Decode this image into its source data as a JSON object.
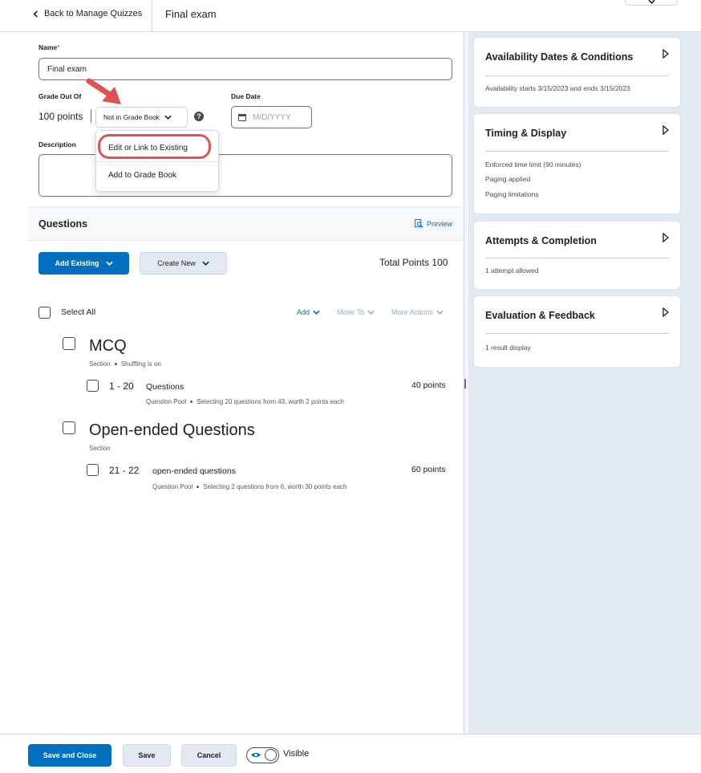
{
  "header": {
    "back_label": "Back to Manage Quizzes",
    "title": "Final exam"
  },
  "form": {
    "name_label": "Name",
    "name_required_mark": "*",
    "name_value": "Final exam",
    "grade_label": "Grade Out Of",
    "grade_points": "100 points",
    "gradebook_select": "Not in Grade Book",
    "help_glyph": "?",
    "due_label": "Due Date",
    "due_placeholder": "M/D/YYYY",
    "description_label": "Description"
  },
  "gradebook_menu": {
    "items": [
      {
        "label": "Edit or Link to Existing"
      },
      {
        "label": "Add to Grade Book"
      }
    ]
  },
  "questions": {
    "title": "Questions",
    "preview": "Preview",
    "add_existing": "Add Existing",
    "create_new": "Create New",
    "total_points": "Total Points 100",
    "select_all": "Select All",
    "toolbar": {
      "add": "Add",
      "move_to": "Move To",
      "more_actions": "More Actions"
    },
    "sections": [
      {
        "title": "MCQ",
        "meta_type": "Section",
        "meta_extra": "Shuffling is on",
        "pool": {
          "range": "1 - 20",
          "name": "Questions",
          "points": "40 points",
          "meta_type": "Question Pool",
          "meta_detail": "Selecting 20 questions from 43, worth 2 points each"
        }
      },
      {
        "title": "Open-ended Questions",
        "meta_type": "Section",
        "pool": {
          "range": "21 - 22",
          "name": "open-ended questions",
          "points": "60 points",
          "meta_type": "Question Pool",
          "meta_detail": "Selecting 2 questions from 6, worth 30 points each"
        }
      }
    ]
  },
  "side_panel": {
    "cards": [
      {
        "title": "Availability Dates & Conditions",
        "lines": [
          "Availability starts 3/15/2023 and ends 3/15/2023"
        ]
      },
      {
        "title": "Timing & Display",
        "lines": [
          "Enforced time limit (90 minutes)",
          "Paging applied",
          "Paging limitations"
        ]
      },
      {
        "title": "Attempts & Completion",
        "lines": [
          "1 attempt allowed"
        ]
      },
      {
        "title": "Evaluation & Feedback",
        "lines": [
          "1 result display"
        ]
      }
    ]
  },
  "footer": {
    "save_close": "Save and Close",
    "save": "Save",
    "cancel": "Cancel",
    "visible_label": "Visible"
  },
  "colors": {
    "primary": "#006fbf",
    "annotation": "#e05252",
    "panel_bg": "#e3e9f1"
  }
}
